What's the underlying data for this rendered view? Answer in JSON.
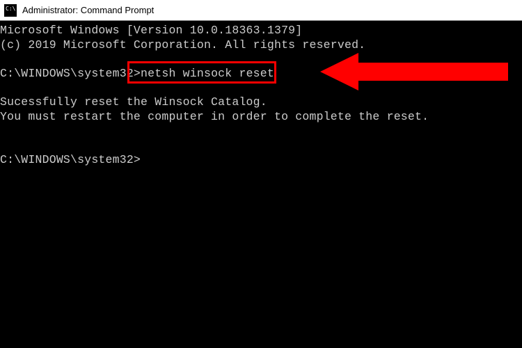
{
  "window": {
    "title": "Administrator: Command Prompt"
  },
  "terminal": {
    "line1": "Microsoft Windows [Version 10.0.18363.1379]",
    "line2": "(c) 2019 Microsoft Corporation. All rights reserved.",
    "blank1": "",
    "prompt1_path": "C:\\WINDOWS\\system32>",
    "prompt1_command": "netsh winsock reset",
    "blank2": "",
    "result1": "Sucessfully reset the Winsock Catalog.",
    "result2": "You must restart the computer in order to complete the reset.",
    "blank3": "",
    "blank4": "",
    "prompt2": "C:\\WINDOWS\\system32>"
  },
  "annotation": {
    "highlight_color": "#ff0000",
    "arrow_color": "#ff0000"
  }
}
